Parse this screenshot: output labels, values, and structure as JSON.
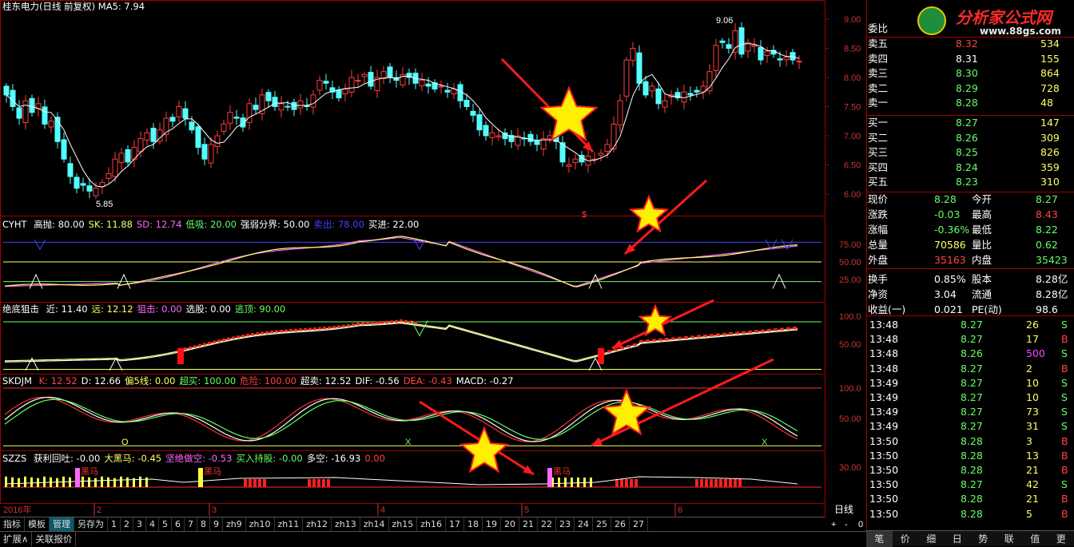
{
  "header": {
    "title": "桂东电力(日线 前复权)",
    "ma": "MA5: 7.94"
  },
  "price_axis": [
    "9.00",
    "8.50",
    "8.00",
    "7.50",
    "7.00",
    "6.50",
    "6.00"
  ],
  "markers": {
    "high": "9.06",
    "low": "5.85",
    "s": "$"
  },
  "cyht": {
    "name": "CYHT",
    "items": [
      {
        "t": "高抛: 80.00",
        "c": "#ffffff"
      },
      {
        "t": "SK: 11.88",
        "c": "#ffff66"
      },
      {
        "t": "SD: 12.74",
        "c": "#ff66ff"
      },
      {
        "t": "低吸: 20.00",
        "c": "#66ff66"
      },
      {
        "t": "强弱分界: 50.00",
        "c": "#ffffff"
      },
      {
        "t": "卖出: 78.00",
        "c": "#4444ff"
      },
      {
        "t": "买进: 22.00",
        "c": "#ffffff"
      }
    ],
    "axis": [
      "75.00",
      "50.00",
      "25.00"
    ]
  },
  "jdzj": {
    "name": "绝底狙击",
    "items": [
      {
        "t": "近: 11.40",
        "c": "#ffffff"
      },
      {
        "t": "远: 12.12",
        "c": "#ffff66"
      },
      {
        "t": "狙击: 0.00",
        "c": "#ff66ff"
      },
      {
        "t": "选股: 0.00",
        "c": "#ffffff"
      },
      {
        "t": "逃顶: 90.00",
        "c": "#66ff66"
      }
    ],
    "axis": [
      "100.0",
      "50.00"
    ]
  },
  "skdjm": {
    "name": "SKDJM",
    "items": [
      {
        "t": "K: 12.52",
        "c": "#ff4444"
      },
      {
        "t": "D: 12.66",
        "c": "#ffffff"
      },
      {
        "t": "偏5线: 0.00",
        "c": "#ffff66"
      },
      {
        "t": "超买: 100.00",
        "c": "#66ff66"
      },
      {
        "t": "危险: 100.00",
        "c": "#ff4444"
      },
      {
        "t": "超卖: 12.52",
        "c": "#ffffff"
      },
      {
        "t": "DIF: -0.56",
        "c": "#ffffff"
      },
      {
        "t": "DEA: -0.43",
        "c": "#ff4444"
      },
      {
        "t": "MACD: -0.27",
        "c": "#ffffff"
      }
    ],
    "axis": [
      "100.0",
      "50.00"
    ],
    "marks": {
      "o": "O",
      "x": "X"
    }
  },
  "szzs": {
    "name": "SZZS",
    "items": [
      {
        "t": "获利回吐: -0.00",
        "c": "#ffffff"
      },
      {
        "t": "大黑马: -0.45",
        "c": "#ffff66"
      },
      {
        "t": "坚绝做空: -0.53",
        "c": "#ff66ff"
      },
      {
        "t": "买入持股: -0.00",
        "c": "#66ff66"
      },
      {
        "t": "多空: -16.93",
        "c": "#ffffff"
      },
      {
        "t": "0.00",
        "c": "#ff4444"
      }
    ],
    "axis": [
      "30.00"
    ],
    "mark": "黑马"
  },
  "xaxis": {
    "year": "2016年",
    "months": [
      "2",
      "3",
      "4",
      "5",
      "6"
    ],
    "period": "日线"
  },
  "quote": {
    "weibi_label": "委比",
    "asks": [
      {
        "l": "卖五",
        "p": "8.32",
        "v": "534"
      },
      {
        "l": "卖四",
        "p": "8.31",
        "v": "155"
      },
      {
        "l": "卖三",
        "p": "8.30",
        "v": "864"
      },
      {
        "l": "卖二",
        "p": "8.29",
        "v": "728"
      },
      {
        "l": "卖一",
        "p": "8.28",
        "v": "48"
      }
    ],
    "bids": [
      {
        "l": "买一",
        "p": "8.27",
        "v": "147"
      },
      {
        "l": "买二",
        "p": "8.26",
        "v": "309"
      },
      {
        "l": "买三",
        "p": "8.25",
        "v": "826"
      },
      {
        "l": "买四",
        "p": "8.24",
        "v": "359"
      },
      {
        "l": "买五",
        "p": "8.23",
        "v": "310"
      }
    ],
    "stats": [
      {
        "l1": "现价",
        "v1": "8.28",
        "c1": "#66ff66",
        "l2": "今开",
        "v2": "8.27",
        "c2": "#66ff66"
      },
      {
        "l1": "涨跌",
        "v1": "-0.03",
        "c1": "#66ff66",
        "l2": "最高",
        "v2": "8.43",
        "c2": "#ff4444"
      },
      {
        "l1": "涨幅",
        "v1": "-0.36%",
        "c1": "#66ff66",
        "l2": "最低",
        "v2": "8.22",
        "c2": "#66ff66"
      },
      {
        "l1": "总量",
        "v1": "70586",
        "c1": "#ffff66",
        "l2": "量比",
        "v2": "0.62",
        "c2": "#66ff66"
      },
      {
        "l1": "外盘",
        "v1": "35163",
        "c1": "#ff4444",
        "l2": "内盘",
        "v2": "35423",
        "c2": "#66ff66"
      },
      {
        "l1": "换手",
        "v1": "0.85%",
        "c1": "#ffffff",
        "l2": "股本",
        "v2": "8.28亿",
        "c2": "#ffffff"
      },
      {
        "l1": "净资",
        "v1": "3.04",
        "c1": "#ffffff",
        "l2": "流通",
        "v2": "8.28亿",
        "c2": "#ffffff"
      },
      {
        "l1": "收益(一)",
        "v1": "0.021",
        "c1": "#ffffff",
        "l2": "PE(动)",
        "v2": "98.6",
        "c2": "#ffffff"
      }
    ],
    "ticks": [
      {
        "t": "13:48",
        "p": "8.27",
        "v": "26",
        "s": "S"
      },
      {
        "t": "13:48",
        "p": "8.27",
        "v": "17",
        "s": "B"
      },
      {
        "t": "13:48",
        "p": "8.26",
        "v": "500",
        "s": "S"
      },
      {
        "t": "13:48",
        "p": "8.27",
        "v": "2",
        "s": "B"
      },
      {
        "t": "13:49",
        "p": "8.27",
        "v": "10",
        "s": "S"
      },
      {
        "t": "13:49",
        "p": "8.27",
        "v": "10",
        "s": "S"
      },
      {
        "t": "13:49",
        "p": "8.27",
        "v": "73",
        "s": "S"
      },
      {
        "t": "13:49",
        "p": "8.27",
        "v": "31",
        "s": "S"
      },
      {
        "t": "13:50",
        "p": "8.28",
        "v": "3",
        "s": "B"
      },
      {
        "t": "13:50",
        "p": "8.28",
        "v": "13",
        "s": "B"
      },
      {
        "t": "13:50",
        "p": "8.28",
        "v": "21",
        "s": "B"
      },
      {
        "t": "13:50",
        "p": "8.27",
        "v": "42",
        "s": "S"
      },
      {
        "t": "13:50",
        "p": "8.28",
        "v": "21",
        "s": "B"
      },
      {
        "t": "13:50",
        "p": "8.28",
        "v": "5",
        "s": "B"
      }
    ]
  },
  "watermark": {
    "title": "分析家公式网",
    "url": "www.88gs.com"
  },
  "tabs": [
    "指标",
    "模板",
    "管理",
    "另存为",
    "1",
    "2",
    "3",
    "4",
    "5",
    "6",
    "7",
    "8",
    "9",
    "zh9",
    "zh10",
    "zh11",
    "zh12",
    "zh13",
    "zh14",
    "zh15",
    "zh16",
    "17",
    "18",
    "19",
    "20",
    "21",
    "22",
    "23",
    "24",
    "25",
    "26",
    "27"
  ],
  "bottom": [
    "扩展∧",
    "关联报价"
  ],
  "scroll": [
    "+",
    "-",
    "0"
  ],
  "rtabs": [
    "笔",
    "价",
    "细",
    "日",
    "势",
    "联",
    "值",
    "更"
  ]
}
